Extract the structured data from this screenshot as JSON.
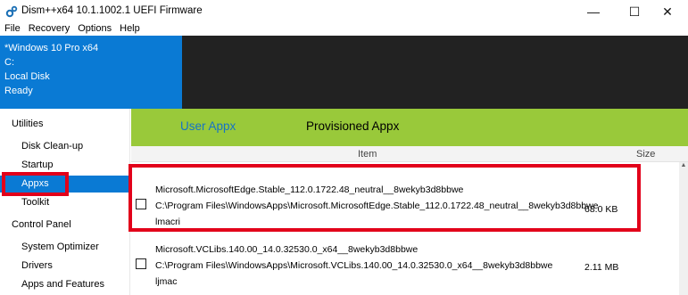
{
  "window": {
    "title": "Dism++x64 10.1.1002.1 UEFI Firmware",
    "minimize_glyph": "—",
    "maximize_glyph": "☐",
    "close_glyph": "✕"
  },
  "menu": {
    "file": "File",
    "recovery": "Recovery",
    "options": "Options",
    "help": "Help"
  },
  "info": {
    "os": "*Windows 10 Pro x64",
    "drive": "C:",
    "disk": "Local Disk",
    "status": "Ready"
  },
  "sidebar": {
    "utilities": "Utilities",
    "disk_cleanup": "Disk Clean-up",
    "startup": "Startup",
    "appxs": "Appxs",
    "toolkit": "Toolkit",
    "control_panel": "Control Panel",
    "system_optimizer": "System Optimizer",
    "drivers": "Drivers",
    "apps_features": "Apps and Features"
  },
  "tabs": {
    "user_appx": "User Appx",
    "provisioned_appx": "Provisioned Appx"
  },
  "columns": {
    "item": "Item",
    "size": "Size"
  },
  "rows": [
    {
      "name": "Microsoft.MicrosoftEdge.Stable_112.0.1722.48_neutral__8wekyb3d8bbwe",
      "path": "C:\\Program Files\\WindowsApps\\Microsoft.MicrosoftEdge.Stable_112.0.1722.48_neutral__8wekyb3d8bbwe",
      "extra": "lmacri",
      "size": "68.0 KB"
    },
    {
      "name": "Microsoft.VCLibs.140.00_14.0.32530.0_x64__8wekyb3d8bbwe",
      "path": "C:\\Program Files\\WindowsApps\\Microsoft.VCLibs.140.00_14.0.32530.0_x64__8wekyb3d8bbwe",
      "extra": "ljmac",
      "size": "2.11 MB"
    }
  ],
  "colors": {
    "accent_blue": "#0a7ad4",
    "tab_green": "#99c93a",
    "highlight_red": "#e2001a",
    "dark_panel": "#222222"
  }
}
